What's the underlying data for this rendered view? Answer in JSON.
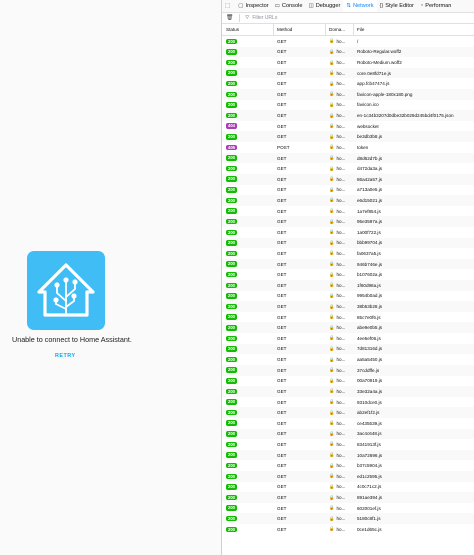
{
  "app": {
    "error_message": "Unable to connect to Home Assistant.",
    "retry_label": "RETRY",
    "brand_color": "#41bdf5"
  },
  "devtools": {
    "tabs": [
      {
        "icon": "inspector-icon",
        "label": "Inspector",
        "active": false
      },
      {
        "icon": "console-icon",
        "label": "Console",
        "active": false
      },
      {
        "icon": "debugger-icon",
        "label": "Debugger",
        "active": false
      },
      {
        "icon": "network-icon",
        "label": "Network",
        "active": true
      },
      {
        "icon": "style-editor-icon",
        "label": "Style Editor",
        "active": false
      },
      {
        "icon": "performance-icon",
        "label": "Performan",
        "active": false
      }
    ],
    "filter_placeholder": "Filter URLs",
    "columns": {
      "status": "Status",
      "method": "Method",
      "domain": "Doma...",
      "file": "File"
    },
    "status_colors": {
      "200": "#12bc00",
      "404": "#a93fb5",
      "405": "#a93fb5"
    },
    "domain_text": "ho...",
    "requests": [
      {
        "status": "200",
        "method": "GET",
        "file": "/"
      },
      {
        "status": "200",
        "method": "GET",
        "file": "Roboto-Regular.woff2"
      },
      {
        "status": "200",
        "method": "GET",
        "file": "Roboto-Medium.woff2"
      },
      {
        "status": "200",
        "method": "GET",
        "file": "core.0e8fd71e.js"
      },
      {
        "status": "200",
        "method": "GET",
        "file": "app.fcb47474.js"
      },
      {
        "status": "200",
        "method": "GET",
        "file": "favicon-apple-180x180.png"
      },
      {
        "status": "200",
        "method": "GET",
        "file": "favicon.ico"
      },
      {
        "status": "200",
        "method": "GET",
        "file": "en-1c34b3207d0dbe32b029d245bd4f0175.json"
      },
      {
        "status": "404",
        "method": "GET",
        "file": "websocket"
      },
      {
        "status": "200",
        "method": "GET",
        "file": "be3db3b8.js"
      },
      {
        "status": "405",
        "method": "POST",
        "file": "token"
      },
      {
        "status": "200",
        "method": "GET",
        "file": "d8d62d7b.js"
      },
      {
        "status": "200",
        "method": "GET",
        "file": "d472da3a.js"
      },
      {
        "status": "200",
        "method": "GET",
        "file": "86a42a57.js"
      },
      {
        "status": "200",
        "method": "GET",
        "file": "a713a0e5.js"
      },
      {
        "status": "200",
        "method": "GET",
        "file": "e6d15021.js"
      },
      {
        "status": "200",
        "method": "GET",
        "file": "1a7ef854.js"
      },
      {
        "status": "200",
        "method": "GET",
        "file": "95e3597a.js"
      },
      {
        "status": "200",
        "method": "GET",
        "file": "1a00f722.js"
      },
      {
        "status": "200",
        "method": "GET",
        "file": "bbb99704.js"
      },
      {
        "status": "200",
        "method": "GET",
        "file": "fa0637a5.js"
      },
      {
        "status": "200",
        "method": "GET",
        "file": "946b746e.js"
      },
      {
        "status": "200",
        "method": "GET",
        "file": "b107602a.js"
      },
      {
        "status": "200",
        "method": "GET",
        "file": "1f60d98a.js"
      },
      {
        "status": "200",
        "method": "GET",
        "file": "9954b0ad.js"
      },
      {
        "status": "200",
        "method": "GET",
        "file": "38b53b28.js"
      },
      {
        "status": "200",
        "method": "GET",
        "file": "85c7e0f6.js"
      },
      {
        "status": "200",
        "method": "GET",
        "file": "abe9e0b5.js"
      },
      {
        "status": "200",
        "method": "GET",
        "file": "4ee5ef06.js"
      },
      {
        "status": "200",
        "method": "GET",
        "file": "7d81316d.js"
      },
      {
        "status": "200",
        "method": "GET",
        "file": "aa5a5450.js"
      },
      {
        "status": "200",
        "method": "GET",
        "file": "37cddffe.js"
      },
      {
        "status": "200",
        "method": "GET",
        "file": "00a70919.js"
      },
      {
        "status": "200",
        "method": "GET",
        "file": "33e32a4a.js"
      },
      {
        "status": "200",
        "method": "GET",
        "file": "9310dce0.js"
      },
      {
        "status": "200",
        "method": "GET",
        "file": "ab2ef1f2.js"
      },
      {
        "status": "200",
        "method": "GET",
        "file": "ce435539.js"
      },
      {
        "status": "200",
        "method": "GET",
        "file": "3ac4c648.js"
      },
      {
        "status": "200",
        "method": "GET",
        "file": "8341913f.js"
      },
      {
        "status": "200",
        "method": "GET",
        "file": "10a72696.js"
      },
      {
        "status": "200",
        "method": "GET",
        "file": "b37c5904.js"
      },
      {
        "status": "200",
        "method": "GET",
        "file": "ed1c2595.js"
      },
      {
        "status": "200",
        "method": "GET",
        "file": "4c0c71c2.js"
      },
      {
        "status": "200",
        "method": "GET",
        "file": "891ae394.js"
      },
      {
        "status": "200",
        "method": "GET",
        "file": "602001ef.js"
      },
      {
        "status": "200",
        "method": "GET",
        "file": "5180c8f1.js"
      },
      {
        "status": "200",
        "method": "GET",
        "file": "0ce1d65c.js"
      }
    ]
  }
}
